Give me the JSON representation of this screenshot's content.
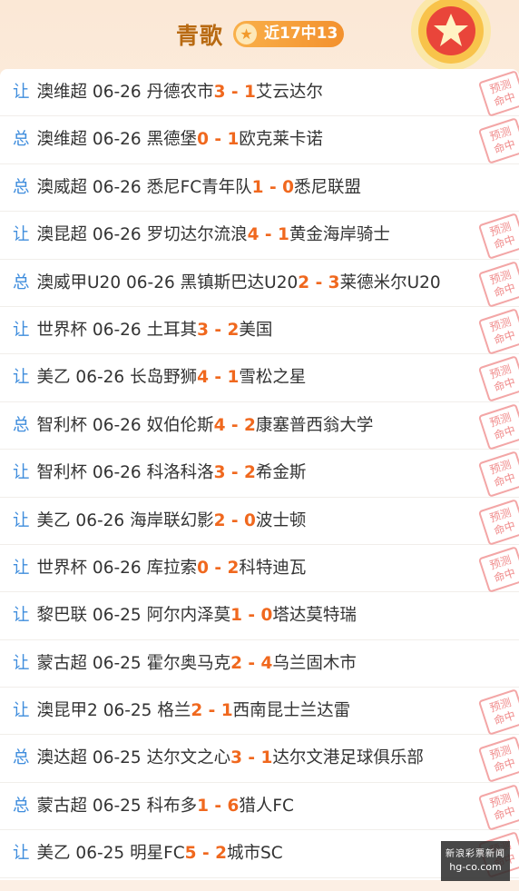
{
  "header": {
    "title": "青歌",
    "badge_text": "近17中13",
    "badge_icon": "star-icon",
    "medal_icon": "medal-star-icon",
    "accent_color": "#f0681e",
    "type_color": "#3f8ddd"
  },
  "stamp_text": "预测命中",
  "matches": [
    {
      "type": "让",
      "league": "澳维超",
      "date": "06-26",
      "home": "丹德农市",
      "score": "3 - 1",
      "away": "艾云达尔",
      "hit": true
    },
    {
      "type": "总",
      "league": "澳维超",
      "date": "06-26",
      "home": "黑德堡",
      "score": "0 - 1",
      "away": "欧克莱卡诺",
      "hit": true
    },
    {
      "type": "总",
      "league": "澳威超",
      "date": "06-26",
      "home": "悉尼FC青年队",
      "score": "1 - 0",
      "away": "悉尼联盟",
      "hit": false
    },
    {
      "type": "让",
      "league": "澳昆超",
      "date": "06-26",
      "home": "罗切达尔流浪",
      "score": "4 - 1",
      "away": "黄金海岸骑士",
      "hit": true
    },
    {
      "type": "总",
      "league": "澳威甲U20",
      "date": "06-26",
      "home": "黑镇斯巴达U20",
      "score": "2 - 3",
      "away": "莱德米尔U20",
      "hit": true
    },
    {
      "type": "让",
      "league": "世界杯",
      "date": "06-26",
      "home": "土耳其",
      "score": "3 - 2",
      "away": "美国",
      "hit": true
    },
    {
      "type": "让",
      "league": "美乙",
      "date": "06-26",
      "home": "长岛野狮",
      "score": "4 - 1",
      "away": "雪松之星",
      "hit": true
    },
    {
      "type": "总",
      "league": "智利杯",
      "date": "06-26",
      "home": "奴伯伦斯",
      "score": "4 - 2",
      "away": "康塞普西翁大学",
      "hit": true
    },
    {
      "type": "让",
      "league": "智利杯",
      "date": "06-26",
      "home": "科洛科洛",
      "score": "3 - 2",
      "away": "希金斯",
      "hit": true
    },
    {
      "type": "让",
      "league": "美乙",
      "date": "06-26",
      "home": "海岸联幻影",
      "score": "2 - 0",
      "away": "波士顿",
      "hit": true
    },
    {
      "type": "让",
      "league": "世界杯",
      "date": "06-26",
      "home": "库拉索",
      "score": "0 - 2",
      "away": "科特迪瓦",
      "hit": true
    },
    {
      "type": "让",
      "league": "黎巴联",
      "date": "06-25",
      "home": "阿尔内泽莫",
      "score": "1 - 0",
      "away": "塔达莫特瑞",
      "hit": false
    },
    {
      "type": "让",
      "league": "蒙古超",
      "date": "06-25",
      "home": "霍尔奥马克",
      "score": "2 - 4",
      "away": "乌兰固木市",
      "hit": false
    },
    {
      "type": "让",
      "league": "澳昆甲2",
      "date": "06-25",
      "home": "格兰",
      "score": "2 - 1",
      "away": "西南昆士兰达雷",
      "hit": true
    },
    {
      "type": "总",
      "league": "澳达超",
      "date": "06-25",
      "home": "达尔文之心",
      "score": "3 - 1",
      "away": "达尔文港足球俱乐部",
      "hit": true
    },
    {
      "type": "总",
      "league": "蒙古超",
      "date": "06-25",
      "home": "科布多",
      "score": "1 - 6",
      "away": "猎人FC",
      "hit": true
    },
    {
      "type": "让",
      "league": "美乙",
      "date": "06-25",
      "home": "明星FC",
      "score": "5 - 2",
      "away": "城市SC",
      "hit": true
    }
  ],
  "watermark": {
    "line1": "新浪彩票新闻",
    "line2": "hg-co.com"
  }
}
